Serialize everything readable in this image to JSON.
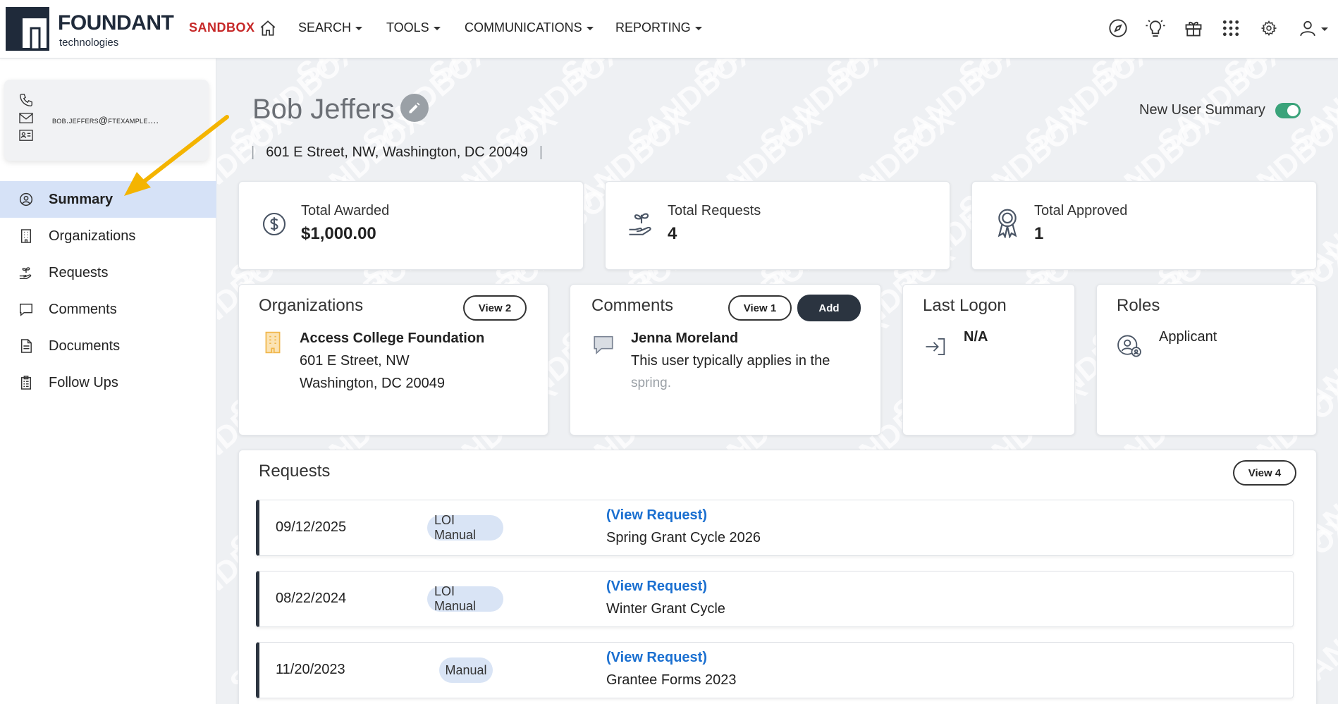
{
  "header": {
    "logo_name": "FOUNDANT",
    "logo_sub": "technologies",
    "sandbox": "SANDBOX",
    "menus": [
      "SEARCH",
      "TOOLS",
      "COMMUNICATIONS",
      "REPORTING"
    ],
    "right_icons": [
      "compass-icon",
      "lightbulb-icon",
      "gift-icon",
      "apps-grid-icon",
      "gear-icon",
      "user-icon"
    ]
  },
  "sidebar": {
    "email": "bob.jeffers@FTExample....",
    "items": [
      {
        "label": "Summary",
        "icon": "user-circle-icon",
        "active": true
      },
      {
        "label": "Organizations",
        "icon": "building-icon"
      },
      {
        "label": "Requests",
        "icon": "hand-plant-icon"
      },
      {
        "label": "Comments",
        "icon": "comment-icon"
      },
      {
        "label": "Documents",
        "icon": "document-icon"
      },
      {
        "label": "Follow Ups",
        "icon": "clipboard-icon"
      }
    ]
  },
  "profile": {
    "name": "Bob Jeffers",
    "address": "601 E Street, NW, Washington, DC 20049",
    "new_user_summary_label": "New User Summary",
    "new_user_summary_on": true
  },
  "stats": [
    {
      "label": "Total Awarded",
      "value": "$1,000.00",
      "icon": "dollar-icon"
    },
    {
      "label": "Total Requests",
      "value": "4",
      "icon": "hand-plant-icon"
    },
    {
      "label": "Total Approved",
      "value": "1",
      "icon": "award-ribbon-icon"
    }
  ],
  "organizations": {
    "title": "Organizations",
    "view_label": "View 2",
    "org_name": "Access College Foundation",
    "org_street": "601 E Street, NW",
    "org_city": "Washington, DC 20049"
  },
  "comments": {
    "title": "Comments",
    "view_label": "View 1",
    "add_label": "Add",
    "author": "Jenna Moreland",
    "text_line1": "This user typically applies in the",
    "text_line2": "spring."
  },
  "last_logon": {
    "title": "Last Logon",
    "value": "N/A"
  },
  "roles": {
    "title": "Roles",
    "value": "Applicant"
  },
  "requests": {
    "title": "Requests",
    "view_label": "View 4",
    "rows": [
      {
        "date": "09/12/2025",
        "type": "LOI Manual",
        "link": "(View Request)",
        "name": "Spring Grant Cycle 2026"
      },
      {
        "date": "08/22/2024",
        "type": "LOI Manual",
        "link": "(View Request)",
        "name": "Winter Grant Cycle"
      },
      {
        "date": "11/20/2023",
        "type": "Manual",
        "link": "(View Request)",
        "name": "Grantee Forms 2023"
      }
    ]
  },
  "watermark_text": "SANDBOX",
  "colors": {
    "accent_red": "#c62828",
    "active_nav": "#d6e2f7",
    "link_blue": "#1a6fd0",
    "toggle_green": "#3aa37a",
    "dark_button": "#2b3440",
    "arrow_yellow": "#f4b400"
  }
}
